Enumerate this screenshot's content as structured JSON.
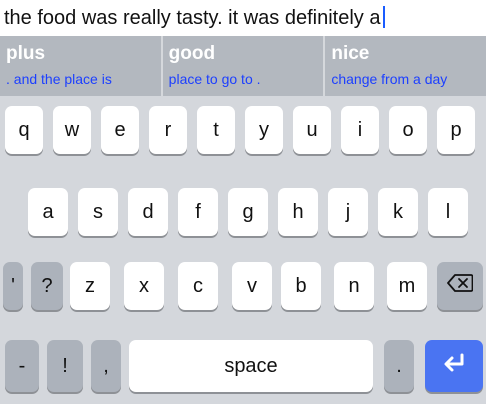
{
  "text_input": {
    "value": "the food was really tasty. it was definitely a"
  },
  "suggestions": [
    {
      "word": "plus",
      "continuation": ". and the place is"
    },
    {
      "word": "good",
      "continuation": "place to go to ."
    },
    {
      "word": "nice",
      "continuation": "change from a day"
    }
  ],
  "keyboard": {
    "row1": [
      "q",
      "w",
      "e",
      "r",
      "t",
      "y",
      "u",
      "i",
      "o",
      "p"
    ],
    "row2": [
      "a",
      "s",
      "d",
      "f",
      "g",
      "h",
      "j",
      "k",
      "l"
    ],
    "row3": {
      "left": [
        "'",
        "?"
      ],
      "letters": [
        "z",
        "x",
        "c",
        "v",
        "b",
        "n",
        "m"
      ],
      "delete_icon": "backspace-icon"
    },
    "row4": {
      "left": [
        "-",
        "!",
        ","
      ],
      "space": "space",
      "right": [
        "."
      ],
      "enter_icon": "return-icon"
    }
  },
  "colors": {
    "caret": "#1a5cff",
    "enter_key": "#4a74f2",
    "suggestion_text": "#1c3fff"
  }
}
